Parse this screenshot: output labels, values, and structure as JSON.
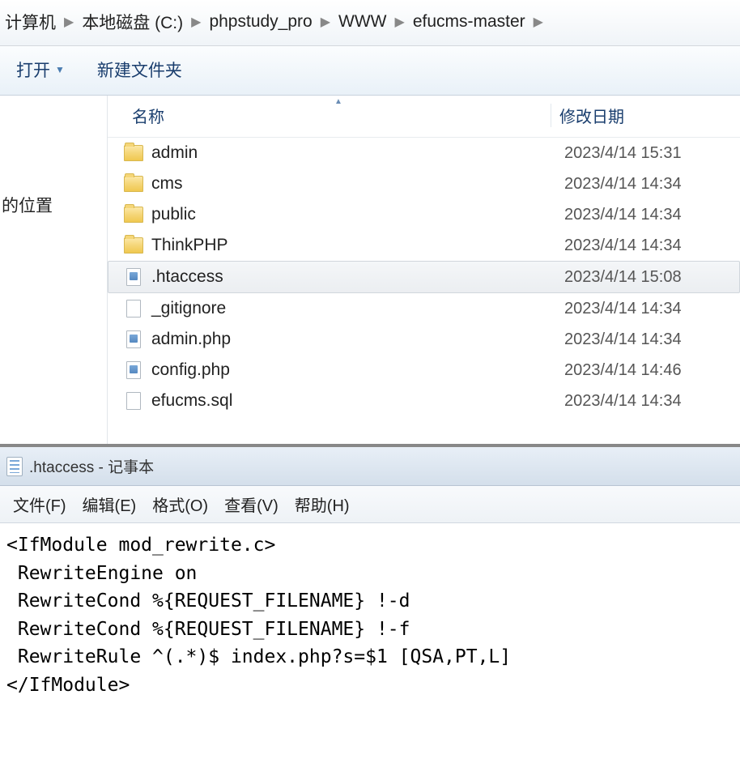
{
  "breadcrumb": {
    "items": [
      {
        "label": "计算机"
      },
      {
        "label": "本地磁盘 (C:)"
      },
      {
        "label": "phpstudy_pro"
      },
      {
        "label": "WWW"
      },
      {
        "label": "efucms-master"
      }
    ]
  },
  "toolbar": {
    "open_label": "打开",
    "new_folder_label": "新建文件夹"
  },
  "left_panel": {
    "label": "的位置"
  },
  "columns": {
    "name": "名称",
    "date": "修改日期"
  },
  "files": [
    {
      "name": "admin",
      "date": "2023/4/14 15:31",
      "type": "folder"
    },
    {
      "name": "cms",
      "date": "2023/4/14 14:34",
      "type": "folder"
    },
    {
      "name": "public",
      "date": "2023/4/14 14:34",
      "type": "folder"
    },
    {
      "name": "ThinkPHP",
      "date": "2023/4/14 14:34",
      "type": "folder"
    },
    {
      "name": ".htaccess",
      "date": "2023/4/14 15:08",
      "type": "file-doc",
      "selected": true
    },
    {
      "name": "_gitignore",
      "date": "2023/4/14 14:34",
      "type": "file"
    },
    {
      "name": "admin.php",
      "date": "2023/4/14 14:34",
      "type": "file-doc"
    },
    {
      "name": "config.php",
      "date": "2023/4/14 14:46",
      "type": "file-doc"
    },
    {
      "name": "efucms.sql",
      "date": "2023/4/14 14:34",
      "type": "file"
    }
  ],
  "notepad": {
    "title": ".htaccess - 记事本",
    "menu": {
      "file": "文件(F)",
      "edit": "编辑(E)",
      "format": "格式(O)",
      "view": "查看(V)",
      "help": "帮助(H)"
    },
    "content": "<IfModule mod_rewrite.c>\n RewriteEngine on\n RewriteCond %{REQUEST_FILENAME} !-d\n RewriteCond %{REQUEST_FILENAME} !-f\n RewriteRule ^(.*)$ index.php?s=$1 [QSA,PT,L]\n</IfModule>"
  }
}
